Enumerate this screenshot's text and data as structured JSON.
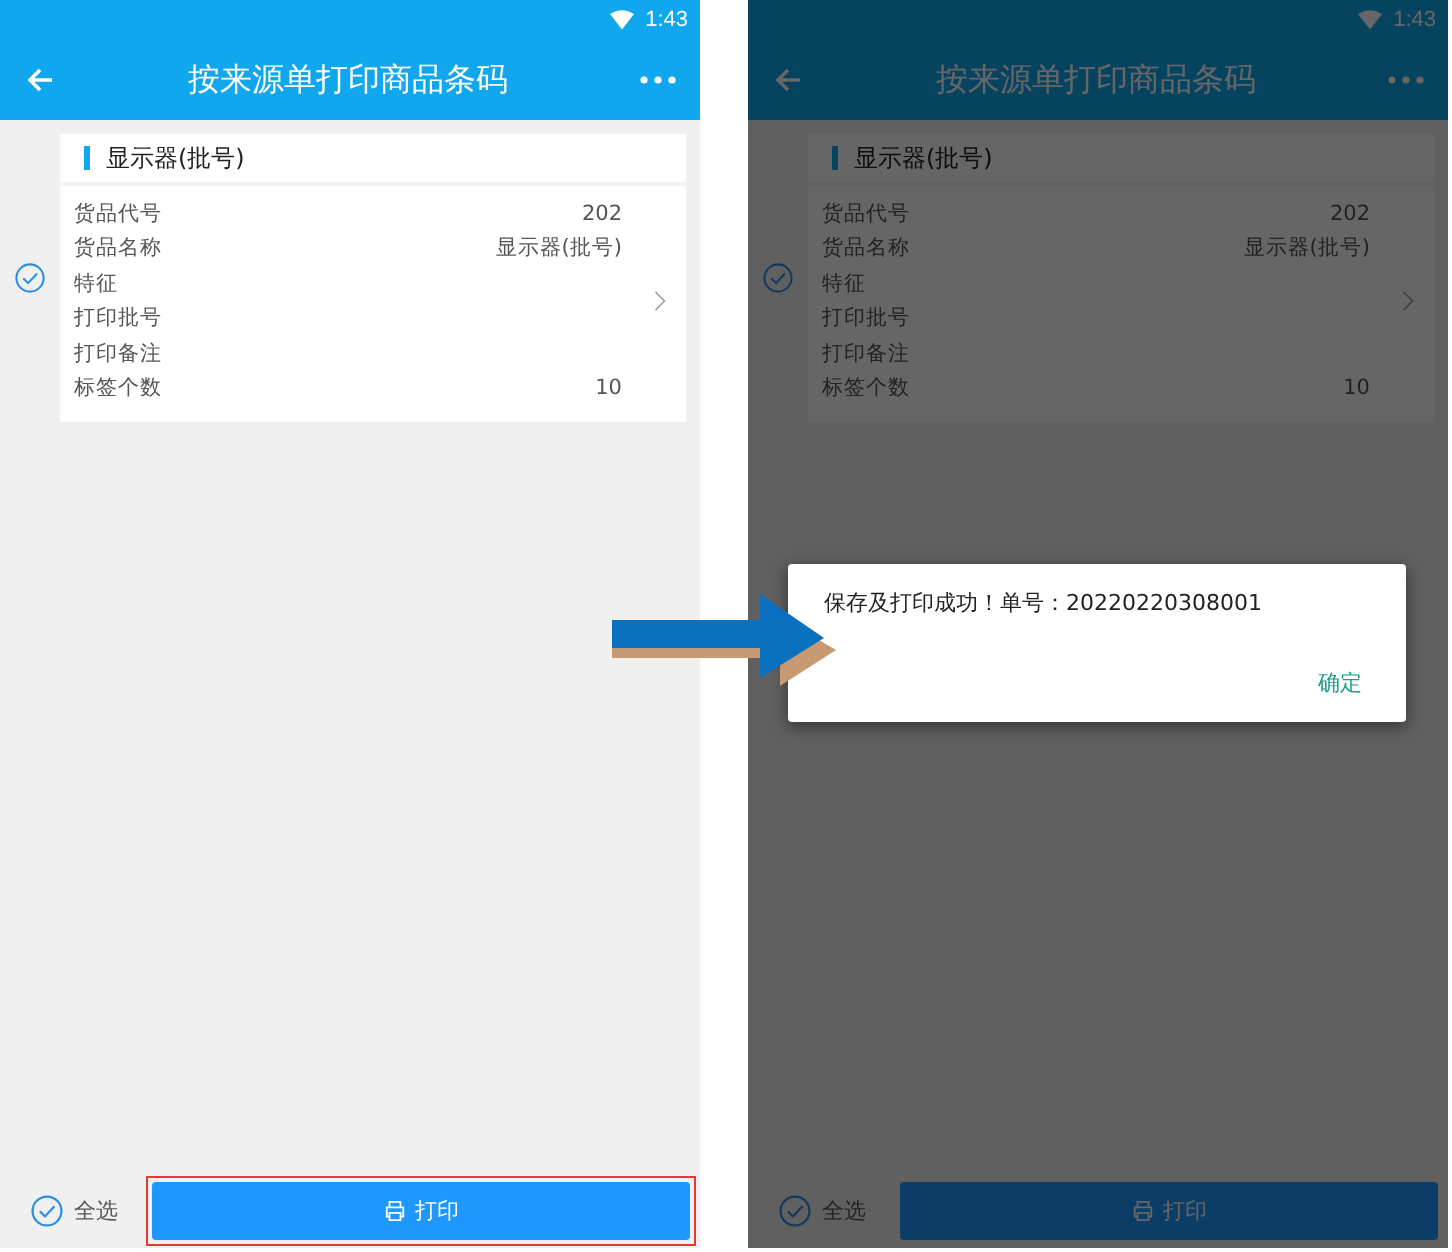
{
  "screens": [
    {
      "status_time": "1:43",
      "title": "按来源单打印商品条码",
      "card": {
        "title": "显示器(批号)",
        "selected": true,
        "fields": [
          {
            "label": "货品代号",
            "value": "202"
          },
          {
            "label": "货品名称",
            "value": "显示器(批号)"
          },
          {
            "label": "特征"
          },
          {
            "label": "打印批号"
          },
          {
            "label": "打印备注"
          },
          {
            "label": "标签个数",
            "value": "10"
          }
        ]
      },
      "select_all": {
        "label": "全选",
        "checked": true
      },
      "print_button": {
        "label": "打印",
        "highlighted": true
      }
    },
    {
      "status_time": "1:43",
      "title": "按来源单打印商品条码",
      "card": {
        "title": "显示器(批号)",
        "selected": true,
        "fields": [
          {
            "label": "货品代号",
            "value": "202"
          },
          {
            "label": "货品名称",
            "value": "显示器(批号)"
          },
          {
            "label": "特征"
          },
          {
            "label": "打印批号"
          },
          {
            "label": "打印备注"
          },
          {
            "label": "标签个数",
            "value": "10"
          }
        ]
      },
      "select_all": {
        "label": "全选",
        "checked": true
      },
      "print_button": {
        "label": "打印",
        "highlighted": false
      },
      "dimmed": true,
      "dialog": {
        "message": "保存及打印成功！单号：20220220308001",
        "confirm": "确定"
      }
    }
  ]
}
